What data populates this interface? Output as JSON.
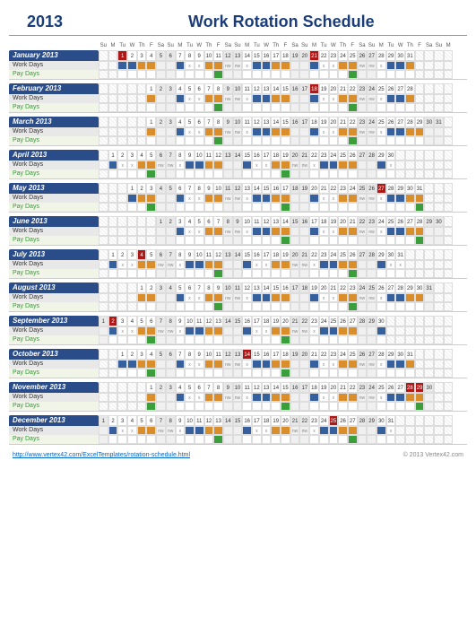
{
  "header": {
    "year": "2013",
    "title": "Work Rotation Schedule"
  },
  "labels": {
    "work": "Work Days",
    "pay": "Pay Days"
  },
  "dow": [
    "Su",
    "M",
    "Tu",
    "W",
    "Th",
    "F",
    "Sa",
    "Su",
    "M",
    "Tu",
    "W",
    "Th",
    "F",
    "Sa",
    "Su",
    "M",
    "Tu",
    "W",
    "Th",
    "F",
    "Sa",
    "Su",
    "M",
    "Tu",
    "W",
    "Th",
    "F",
    "Sa",
    "Su",
    "M",
    "Tu",
    "W",
    "Th",
    "F",
    "Sa",
    "Su",
    "M"
  ],
  "months": [
    {
      "name": "January 2013",
      "offset": 2,
      "days": 31,
      "holidays": [
        1,
        21
      ],
      "pattern_start": 0,
      "pay": [
        11,
        25
      ]
    },
    {
      "name": "February 2013",
      "offset": 5,
      "days": 28,
      "holidays": [
        18
      ],
      "pattern_start": 3,
      "pay": [
        8,
        22
      ]
    },
    {
      "name": "March 2013",
      "offset": 5,
      "days": 31,
      "holidays": [],
      "pattern_start": 3,
      "pay": [
        8,
        22
      ]
    },
    {
      "name": "April 2013",
      "offset": 1,
      "days": 30,
      "holidays": [],
      "pattern_start": 6,
      "pay": [
        5,
        19
      ]
    },
    {
      "name": "May 2013",
      "offset": 3,
      "days": 31,
      "holidays": [
        27
      ],
      "pattern_start": 1,
      "pay": [
        3,
        17,
        31
      ]
    },
    {
      "name": "June 2013",
      "offset": 6,
      "days": 30,
      "holidays": [],
      "pattern_start": 4,
      "pay": [
        14,
        28
      ]
    },
    {
      "name": "July 2013",
      "offset": 1,
      "days": 31,
      "holidays": [
        4
      ],
      "pattern_start": 6,
      "pay": [
        12,
        26
      ]
    },
    {
      "name": "August 2013",
      "offset": 4,
      "days": 31,
      "holidays": [],
      "pattern_start": 2,
      "pay": [
        9,
        23
      ]
    },
    {
      "name": "September 2013",
      "offset": 0,
      "days": 30,
      "holidays": [
        2
      ],
      "pattern_start": 5,
      "pay": [
        6,
        20
      ]
    },
    {
      "name": "October 2013",
      "offset": 2,
      "days": 31,
      "holidays": [
        14
      ],
      "pattern_start": 0,
      "pay": [
        4,
        18
      ]
    },
    {
      "name": "November 2013",
      "offset": 5,
      "days": 30,
      "holidays": [
        28,
        29
      ],
      "pattern_start": 3,
      "pay": [
        1,
        15,
        29
      ]
    },
    {
      "name": "December 2013",
      "offset": 0,
      "days": 31,
      "holidays": [
        25
      ],
      "pattern_start": 5,
      "pay": [
        13,
        27
      ]
    }
  ],
  "work_pattern": [
    "b",
    "b",
    "o",
    "o",
    "b",
    "b",
    "b",
    "x",
    "x",
    "o",
    "o",
    "x",
    "x",
    "x"
  ],
  "work_text": {
    "b": "",
    "o": "",
    "x": "x"
  },
  "nw_text": "nw",
  "footer": {
    "link": "http://www.vertex42.com/ExcelTemplates/rotation-schedule.html",
    "copyright": "© 2013 Vertex42.com"
  }
}
